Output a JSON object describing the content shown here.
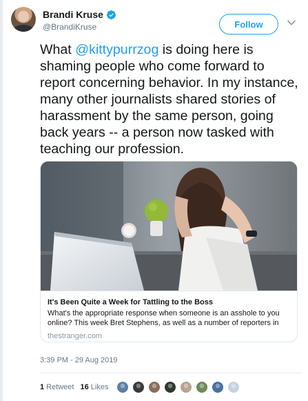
{
  "author": {
    "display_name": "Brandi Kruse",
    "handle": "@BrandiKruse",
    "verified": true
  },
  "actions": {
    "follow_label": "Follow"
  },
  "tweet": {
    "text_before_mention": "What ",
    "mention": "@kittypurrzog",
    "text_after_mention": " is doing here is shaming people who come forward to report concerning behavior. In my instance, many other journalists shared stories of harassment by the same person, going back years -- a person now tasked with teaching our profession."
  },
  "card": {
    "title": "It's Been Quite a Week for Tattling to the Boss",
    "description": "What's the appropriate response when someone is an asshole to you online? This week Bret Stephens, as well as a number of reporters in",
    "domain": "thestranger.com"
  },
  "timestamp": "3:39 PM - 29 Aug 2019",
  "stats": {
    "retweets_count": "1",
    "retweets_label": "Retweet",
    "likes_count": "16",
    "likes_label": "Likes"
  },
  "colors": {
    "accent": "#1da1f2",
    "muted": "#657786",
    "text": "#14171a"
  },
  "liker_avatars": [
    "#5b7fa8",
    "#3a3a3a",
    "#8a6e5a",
    "#2f3a2f",
    "#b9a48e",
    "#6d8a5a",
    "#4a6fa0",
    "#c7d3df"
  ]
}
